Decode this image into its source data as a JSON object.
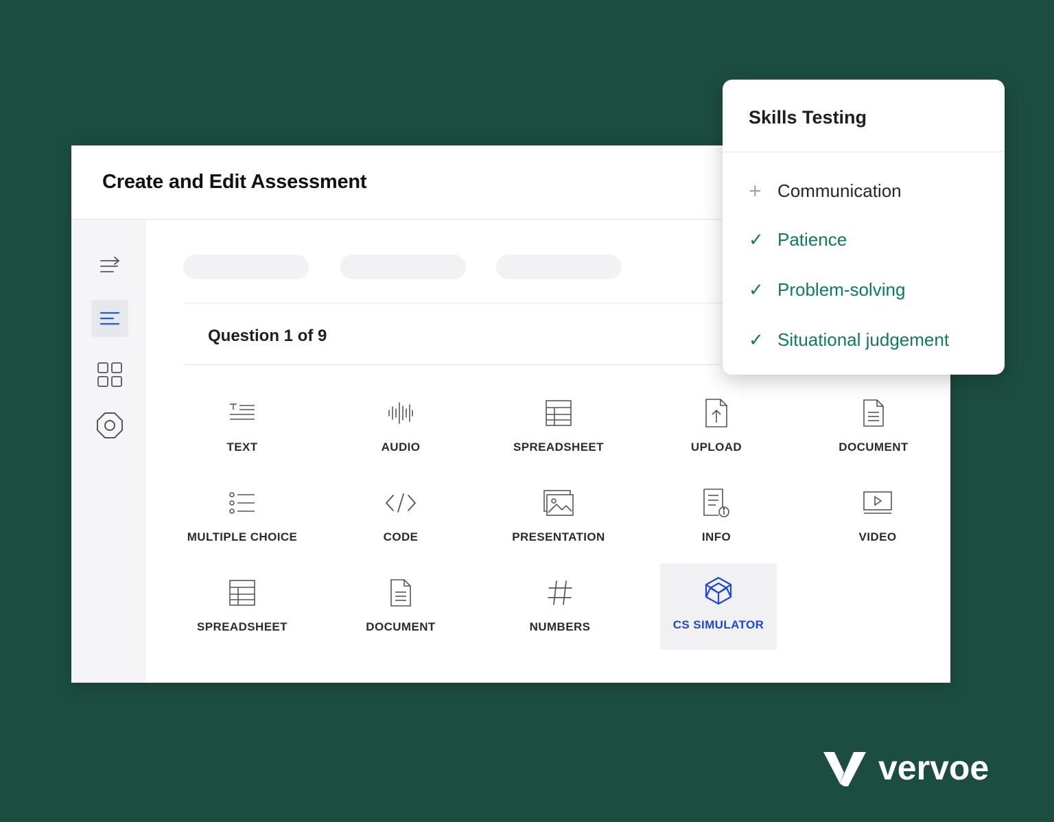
{
  "window": {
    "title": "Create and Edit Assessment"
  },
  "side_rail": {
    "items": [
      {
        "icon": "collapse-arrow-icon",
        "active": false
      },
      {
        "icon": "text-align-icon",
        "active": true
      },
      {
        "icon": "grid-icon",
        "active": false
      },
      {
        "icon": "octagon-icon",
        "active": false
      }
    ]
  },
  "question": {
    "title": "Question 1 of 9"
  },
  "response_types": [
    {
      "label": "TEXT",
      "icon": "text-icon"
    },
    {
      "label": "AUDIO",
      "icon": "audio-waveform-icon"
    },
    {
      "label": "SPREADSHEET",
      "icon": "spreadsheet-icon"
    },
    {
      "label": "UPLOAD",
      "icon": "upload-icon"
    },
    {
      "label": "DOCUMENT",
      "icon": "document-icon"
    },
    {
      "label": "MULTIPLE CHOICE",
      "icon": "list-icon"
    },
    {
      "label": "CODE",
      "icon": "code-icon"
    },
    {
      "label": "PRESENTATION",
      "icon": "presentation-icon"
    },
    {
      "label": "INFO",
      "icon": "info-document-icon"
    },
    {
      "label": "VIDEO",
      "icon": "video-icon"
    },
    {
      "label": "SPREADSHEET",
      "icon": "spreadsheet-icon"
    },
    {
      "label": "DOCUMENT",
      "icon": "document-icon"
    },
    {
      "label": "NUMBERS",
      "icon": "hash-icon"
    },
    {
      "label": "CS SIMULATOR",
      "icon": "cube-icon",
      "selected": true
    }
  ],
  "skills_panel": {
    "title": "Skills Testing",
    "items": [
      {
        "label": "Communication",
        "state": "add",
        "mark": "+"
      },
      {
        "label": "Patience",
        "state": "checked",
        "mark": "✓"
      },
      {
        "label": "Problem-solving",
        "state": "checked",
        "mark": "✓"
      },
      {
        "label": "Situational judgement",
        "state": "checked",
        "mark": "✓"
      }
    ]
  },
  "brand": {
    "name": "vervoe"
  },
  "colors": {
    "background": "#1c4d41",
    "selected_accent": "#1f47d6",
    "skill_checked": "#0f7a5c"
  }
}
